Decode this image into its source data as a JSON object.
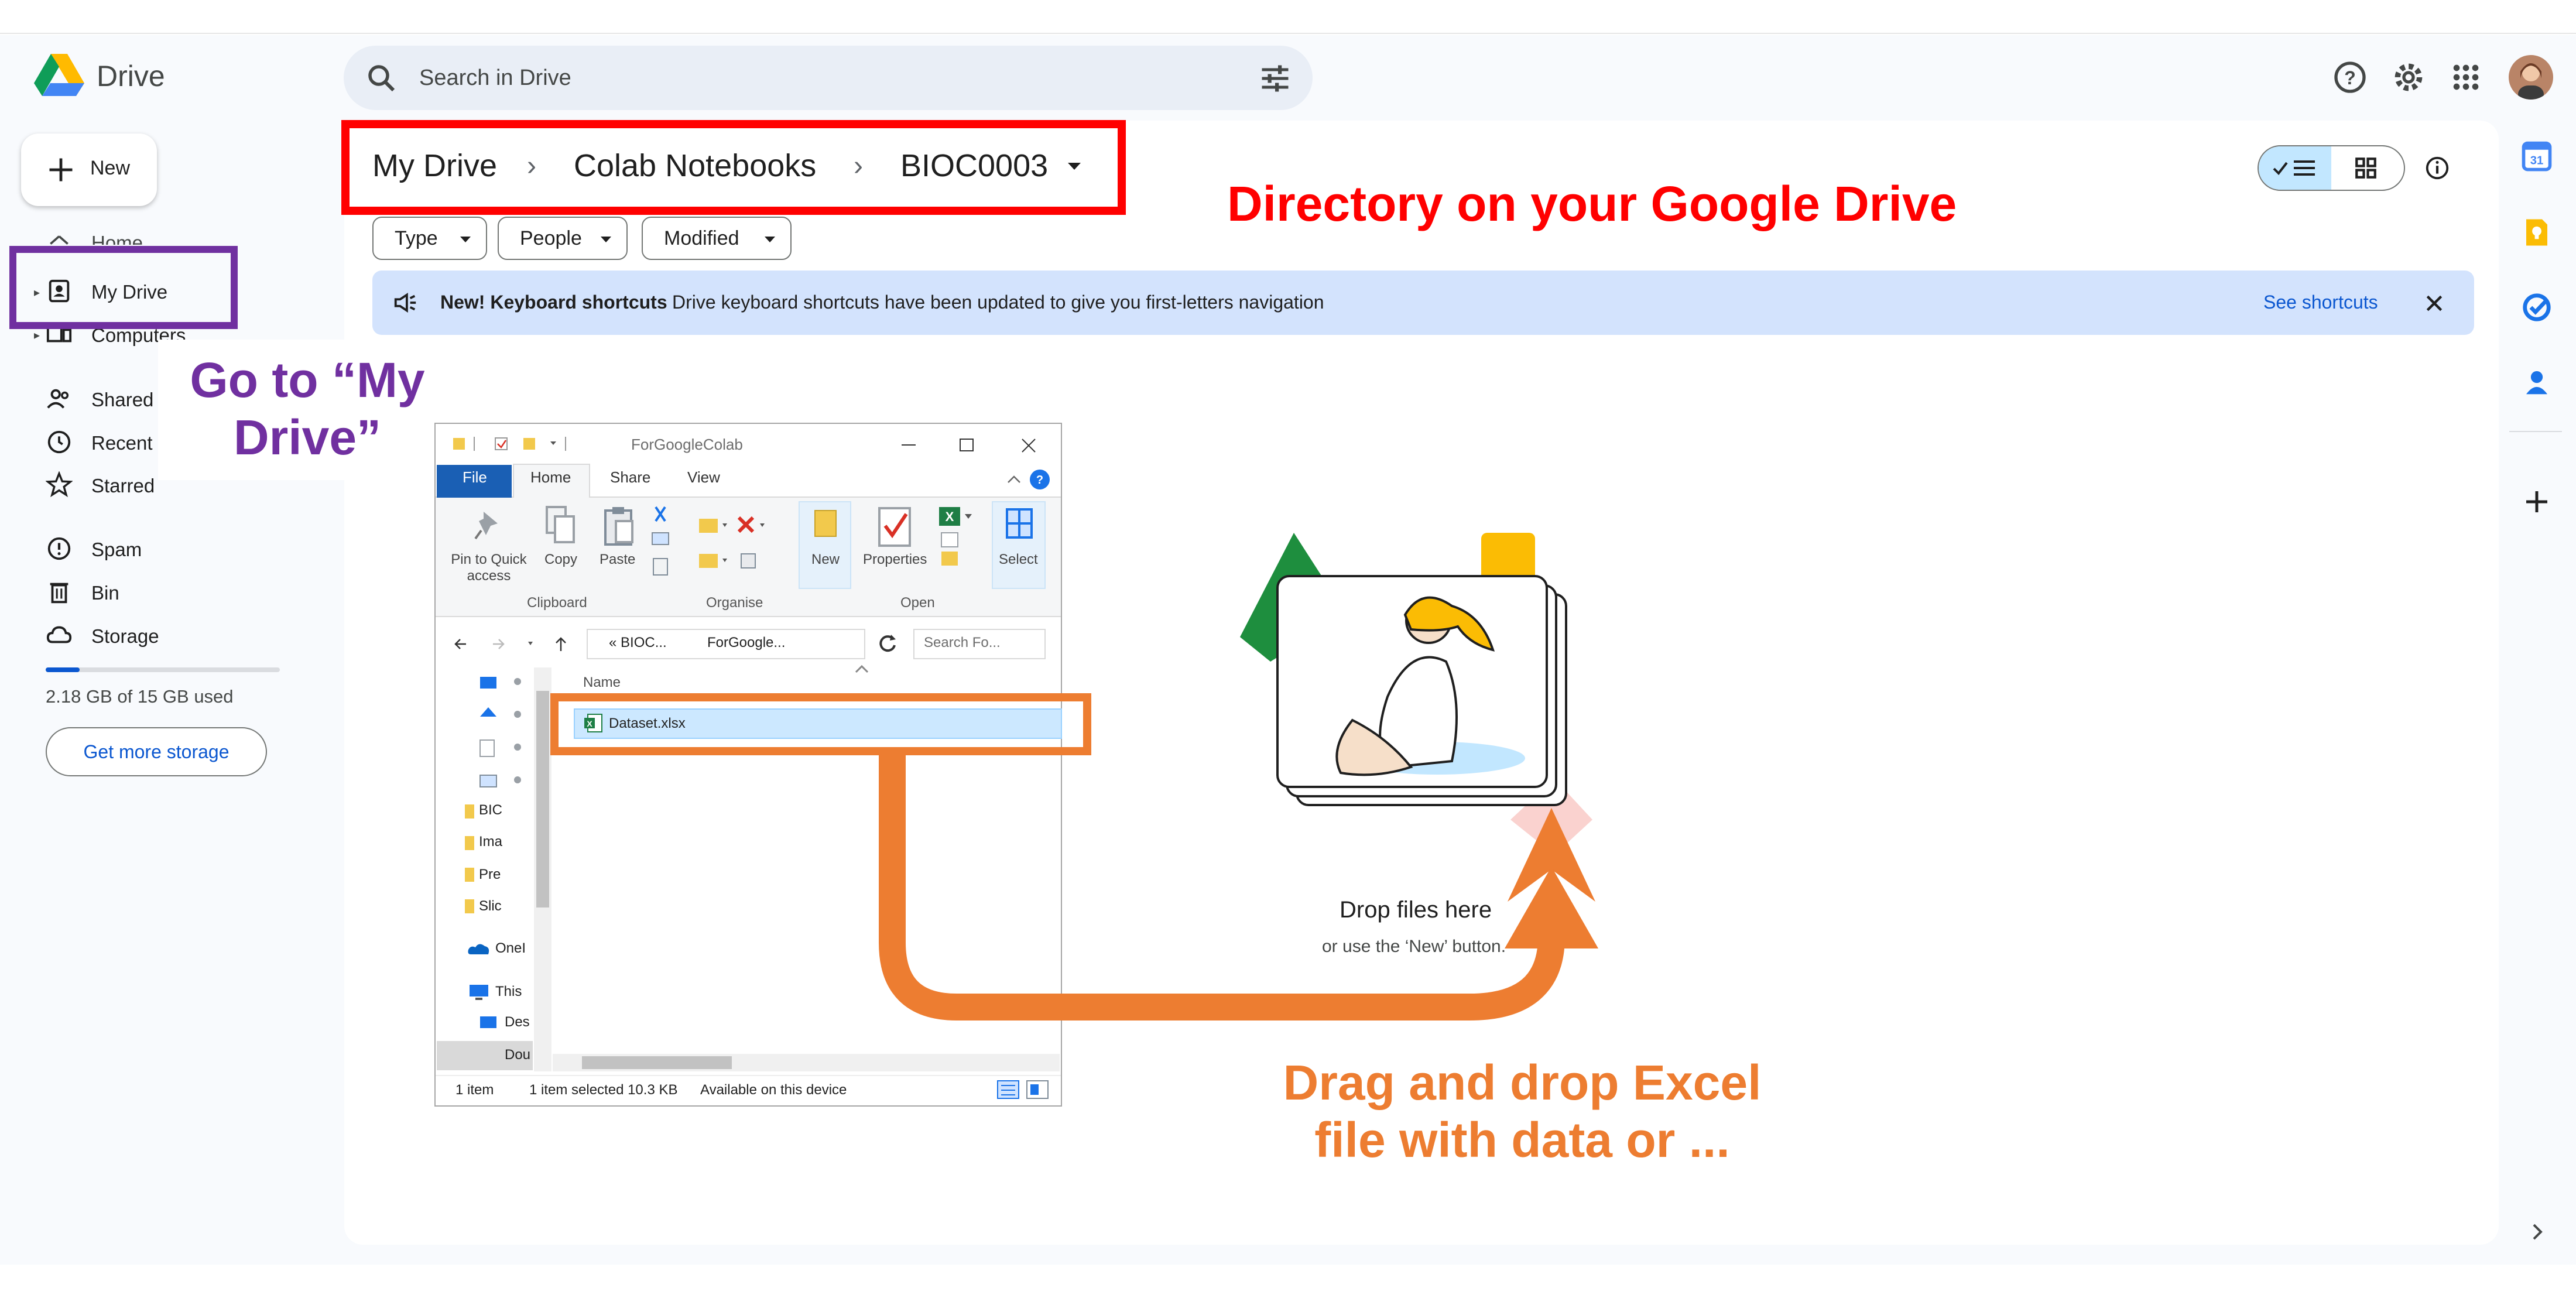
{
  "app": {
    "brand": "Drive",
    "colors": {
      "accent": "#0b57d0",
      "surface": "#f8fafd",
      "banner": "#d3e3fd",
      "annotation_red": "#ff0000",
      "annotation_purple": "#7030a0",
      "annotation_orange": "#ed7d31"
    }
  },
  "header": {
    "search_placeholder": "Search in Drive",
    "icons": [
      "search-icon",
      "tune-icon",
      "help-icon",
      "settings-icon",
      "apps-grid-icon",
      "avatar"
    ]
  },
  "sidebar": {
    "new_label": "New",
    "items": [
      {
        "label": "Home",
        "icon": "home-icon"
      },
      {
        "label": "My Drive",
        "icon": "drive-icon"
      },
      {
        "label": "Computers",
        "icon": "computer-icon"
      },
      {
        "label": "Shared with me",
        "icon": "people-icon"
      },
      {
        "label": "Recent",
        "icon": "clock-icon"
      },
      {
        "label": "Starred",
        "icon": "star-icon"
      },
      {
        "label": "Spam",
        "icon": "spam-icon"
      },
      {
        "label": "Bin",
        "icon": "bin-icon"
      },
      {
        "label": "Storage",
        "icon": "cloud-icon"
      }
    ],
    "storage": {
      "used_fraction": 0.145,
      "text": "2.18 GB of 15 GB used",
      "button": "Get more storage"
    }
  },
  "main": {
    "breadcrumb": [
      "My Drive",
      "Colab Notebooks",
      "BIOC0003"
    ],
    "filters": [
      "Type",
      "People",
      "Modified"
    ],
    "banner": {
      "title": "New! Keyboard shortcuts",
      "body": "Drive keyboard shortcuts have been updated to give you first-letters navigation",
      "link": "See shortcuts"
    },
    "empty_state": {
      "title": "Drop files here",
      "subtitle": "or use the ‘New’ button."
    }
  },
  "annotations": {
    "directory": "Directory on your Google Drive",
    "go_to_my_drive": "Go to “My Drive”",
    "drag_drop": "Drag and drop Excel file with data or ..."
  },
  "explorer": {
    "title": "ForGoogleColab",
    "tabs": [
      "File",
      "Home",
      "Share",
      "View"
    ],
    "ribbon": {
      "buttons": [
        "Pin to Quick access",
        "Copy",
        "Paste",
        "New",
        "Properties",
        "Select"
      ],
      "groups": [
        "Clipboard",
        "Organise",
        "Open"
      ]
    },
    "address": [
      "« BIOC...",
      "ForGoogle..."
    ],
    "search_placeholder": "Search Fo...",
    "column_header": "Name",
    "file": "Dataset.xlsx",
    "nav_items": [
      "BIC",
      "Ima",
      "Pre",
      "Slic",
      "OneI",
      "This",
      "Des",
      "Dou"
    ],
    "status": [
      "1 item",
      "1 item selected  10.3 KB",
      "Available on this device"
    ]
  }
}
